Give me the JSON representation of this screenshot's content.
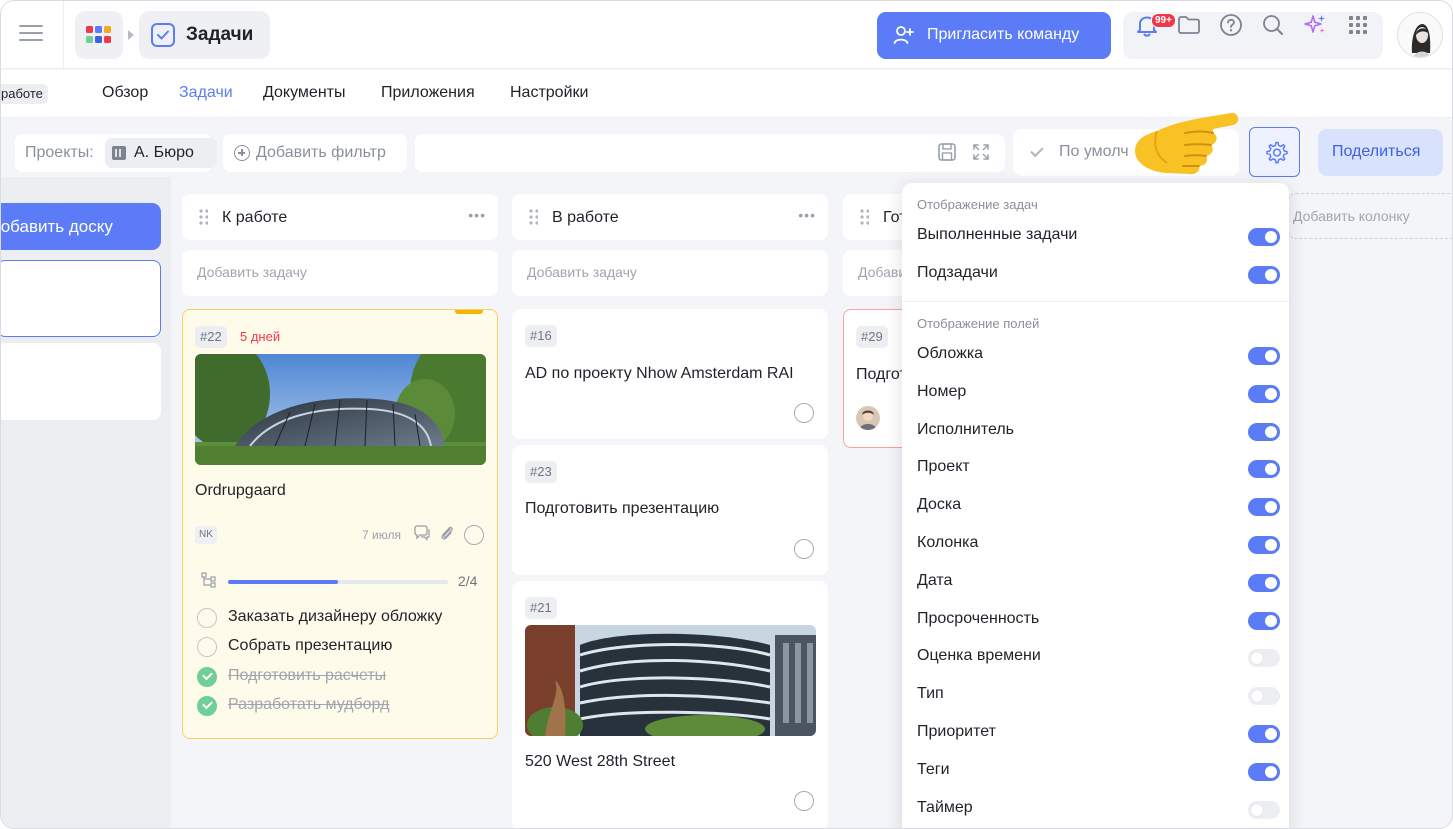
{
  "header": {
    "breadcrumb": {
      "current": "Задачи"
    },
    "invite_label": "Пригласить команду",
    "notifications_badge": "99+"
  },
  "tabs": {
    "current_tag": "работе",
    "items": [
      {
        "label": "Обзор"
      },
      {
        "label": "Задачи"
      },
      {
        "label": "Документы"
      },
      {
        "label": "Приложения"
      },
      {
        "label": "Настройки"
      }
    ]
  },
  "filters": {
    "projects_label": "Проекты:",
    "project_value": "А. Бюро",
    "add_filter_label": "Добавить фильтр",
    "sort_label": "По умолч",
    "share_label": "Поделиться"
  },
  "sidebar": {
    "add_board_label": "Добавить доску"
  },
  "columns": [
    {
      "title": "К работе",
      "add_task": "Добавить задачу"
    },
    {
      "title": "В работе",
      "add_task": "Добавить задачу"
    },
    {
      "title": "Готово",
      "add_task": "Добавить задачу"
    }
  ],
  "add_column_label": "Добавить колонку",
  "cards": {
    "c22": {
      "num": "#22",
      "days": "5 дней",
      "title": "Ordrupgaard",
      "assignee": "NK",
      "date": "7 июля",
      "progress": {
        "done": 2,
        "total": 4,
        "label": "2/4"
      },
      "subtasks": [
        {
          "text": "Заказать дизайнеру обложку",
          "done": false
        },
        {
          "text": "Собрать презентацию",
          "done": false
        },
        {
          "text": "Подготовить расчеты",
          "done": true
        },
        {
          "text": "Разработать мудборд",
          "done": true
        }
      ]
    },
    "c16": {
      "num": "#16",
      "title": "AD по проекту Nhow Amsterdam RAI"
    },
    "c23": {
      "num": "#23",
      "title": "Подготовить презентацию"
    },
    "c21": {
      "num": "#21",
      "title": "520 West 28th Street"
    },
    "c29": {
      "num": "#29",
      "title": "Подготовить"
    }
  },
  "settings_panel": {
    "section_tasks": "Отображение задач",
    "tasks": [
      {
        "label": "Выполненные задачи",
        "on": true
      },
      {
        "label": "Подзадачи",
        "on": true
      }
    ],
    "section_fields": "Отображение полей",
    "fields": [
      {
        "label": "Обложка",
        "on": true
      },
      {
        "label": "Номер",
        "on": true
      },
      {
        "label": "Исполнитель",
        "on": true
      },
      {
        "label": "Проект",
        "on": true
      },
      {
        "label": "Доска",
        "on": true
      },
      {
        "label": "Колонка",
        "on": true
      },
      {
        "label": "Дата",
        "on": true
      },
      {
        "label": "Просроченность",
        "on": true
      },
      {
        "label": "Оценка времени",
        "on": false
      },
      {
        "label": "Тип",
        "on": false
      },
      {
        "label": "Приоритет",
        "on": true
      },
      {
        "label": "Теги",
        "on": true
      },
      {
        "label": "Таймер",
        "on": false
      }
    ]
  },
  "colors": {
    "accent": "#5b7cf6",
    "overdue": "#f0384a",
    "done": "#6fcf97",
    "highlight_card_bg": "#fffbea",
    "highlight_card_border": "#f4d35e"
  }
}
